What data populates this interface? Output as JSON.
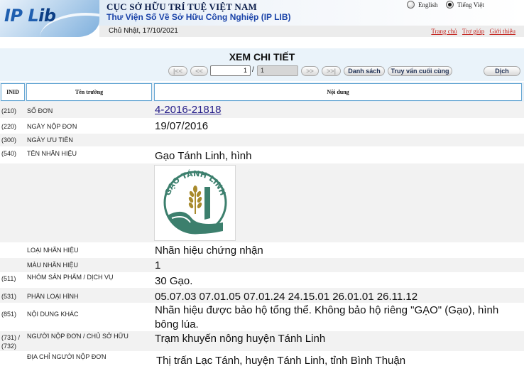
{
  "header": {
    "logo_text_1": "IP L",
    "logo_text_2": "ib",
    "org_title": "CỤC SỞ HỮU TRÍ TUỆ VIỆT NAM",
    "org_subtitle": "Thư Viện Số Về Sở Hữu Công Nghiệp (IP LIB)",
    "languages": [
      {
        "label": "English",
        "selected": false
      },
      {
        "label": "Tiếng Việt",
        "selected": true
      }
    ],
    "date": "Chủ Nhật, 17/10/2021",
    "links": [
      "Trang chủ",
      "Trợ giúp",
      "Giới thiệu"
    ]
  },
  "page": {
    "title": "XEM CHI TIẾT"
  },
  "nav": {
    "first": "|<<",
    "prev": "<<",
    "current_page": "1",
    "separator": "/",
    "total_pages": "1",
    "next": ">>",
    "last": ">>|",
    "list_button": "Danh sách",
    "last_query_button": "Truy vấn cuối cùng",
    "translate_button": "Dịch"
  },
  "table": {
    "headers": {
      "inid": "INID",
      "field": "Tên trường",
      "content": "Nội dung"
    },
    "rows": [
      {
        "inid": "(210)",
        "field": "Số đơn",
        "value": "4-2016-21818"
      },
      {
        "inid": "(220)",
        "field": "Ngày nộp đơn",
        "value": "19/07/2016"
      },
      {
        "inid": "(300)",
        "field": "Ngày ưu tiên",
        "value": ""
      },
      {
        "inid": "(540)",
        "field": "Tên nhãn hiệu",
        "value": "Gạo Tánh Linh, hình"
      },
      {
        "inid": "",
        "field": "",
        "value": ""
      },
      {
        "inid": "",
        "field": "Loại nhãn hiệu",
        "value": "Nhãn hiệu chứng nhận"
      },
      {
        "inid": "",
        "field": "Màu nhãn hiệu",
        "value": "1"
      },
      {
        "inid": "(511)",
        "field": "Nhóm sản phẩm / dịch vụ",
        "value": "30 Gạo."
      },
      {
        "inid": "(531)",
        "field": "Phân loại hình",
        "value": "05.07.03 07.01.05 07.01.24 24.15.01 26.01.01 26.11.12"
      },
      {
        "inid": "(851)",
        "field": "Nội dung khác",
        "value": "Nhãn hiệu được bảo hộ tổng thể. Không bảo hộ riêng \"GẠO\" (Gạo), hình bông lúa."
      },
      {
        "inid": "(731) / (732)",
        "field": "Người nộp đơn / Chủ sở hữu",
        "value": "Trạm khuyến nông huyện Tánh Linh"
      },
      {
        "inid": "",
        "field": "Địa chỉ người nộp đơn",
        "value": "Thị trấn Lạc Tánh, huyện Tánh Linh, tỉnh Bình Thuận"
      }
    ],
    "mark_logo_text": "GẠO TÁNH LINH"
  },
  "colors": {
    "brand_blue": "#1f5fb0",
    "link_red": "#c4241e",
    "header_border": "#6aa9d4",
    "mark_green": "#3c7f6d",
    "mark_gold": "#a88a2c"
  }
}
